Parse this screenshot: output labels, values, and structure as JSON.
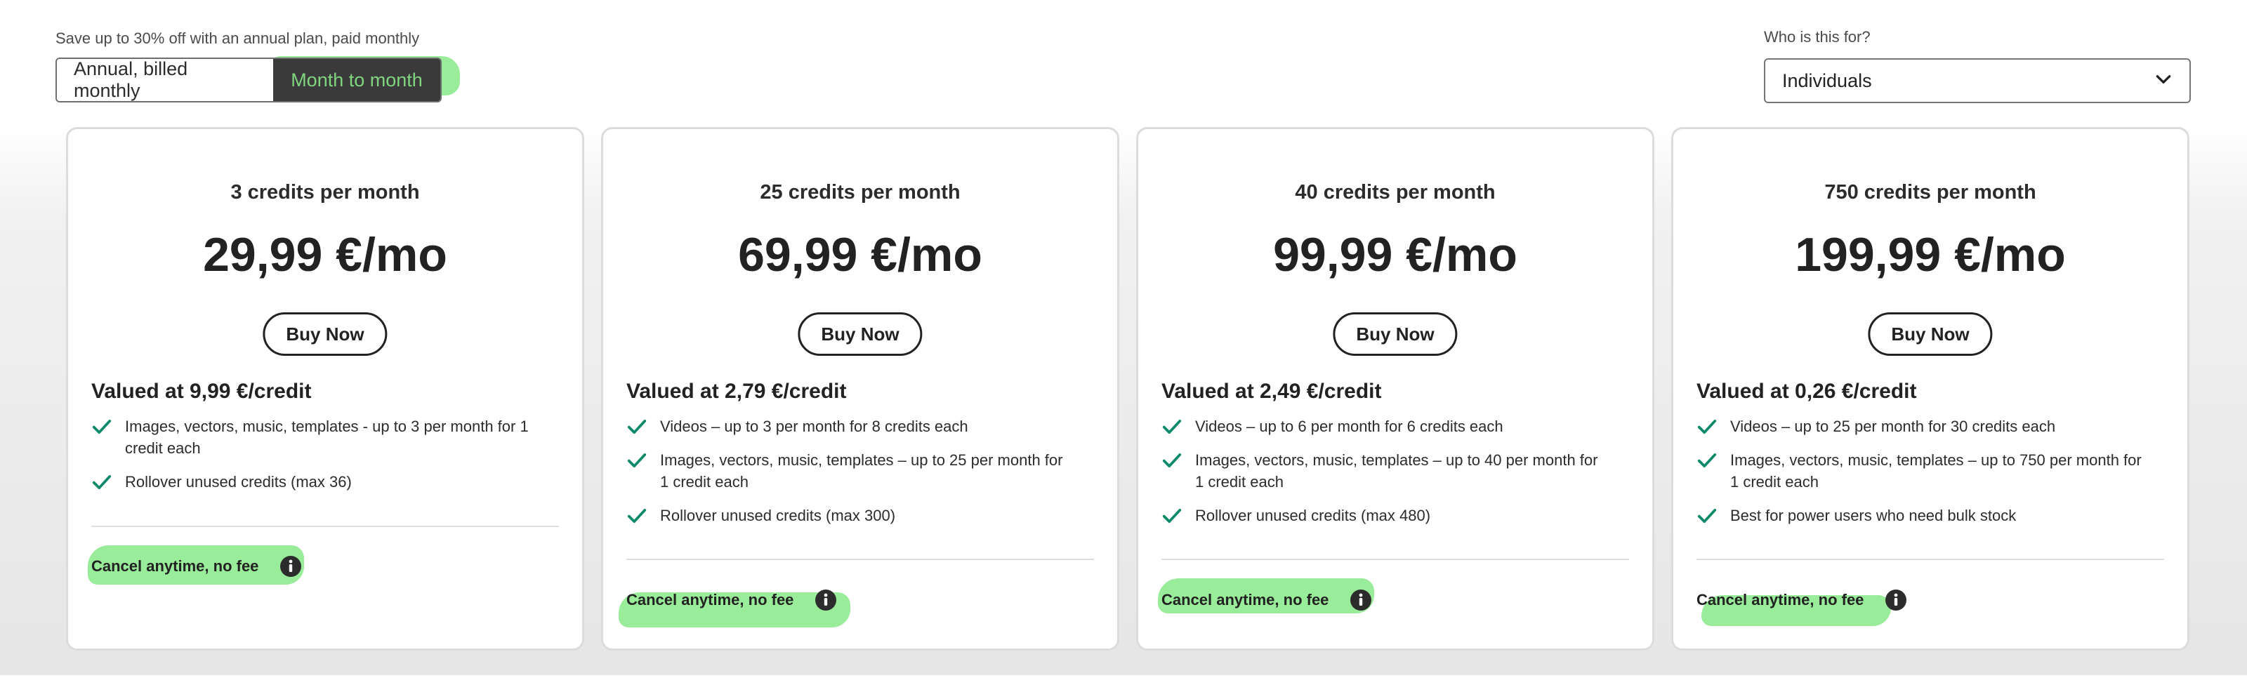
{
  "billing": {
    "save_text": "Save up to 30% off with an annual plan, paid monthly",
    "options": [
      "Annual, billed monthly",
      "Month to month"
    ],
    "selected": "Month to month"
  },
  "audience": {
    "label": "Who is this for?",
    "value": "Individuals"
  },
  "colors": {
    "check": "#0d8a6a",
    "highlight": "#46dc46",
    "toggle_selected_bg": "#3a3a3a"
  },
  "plans": [
    {
      "title": "3 credits per month",
      "price": "29,99 €/mo",
      "buy": "Buy Now",
      "valued": "Valued at 9,99 €/credit",
      "features": [
        "Images, vectors, music, templates - up to 3 per month for 1 credit each",
        "Rollover unused credits (max 36)"
      ],
      "cancel": "Cancel anytime, no fee"
    },
    {
      "title": "25 credits per month",
      "price": "69,99 €/mo",
      "buy": "Buy Now",
      "valued": "Valued at 2,79 €/credit",
      "features": [
        "Videos – up to 3 per month for 8 credits each",
        "Images, vectors, music, templates – up to 25 per month for 1 credit each",
        "Rollover unused credits (max 300)"
      ],
      "cancel": "Cancel anytime, no fee"
    },
    {
      "title": "40 credits per month",
      "price": "99,99 €/mo",
      "buy": "Buy Now",
      "valued": "Valued at 2,49 €/credit",
      "features": [
        "Videos – up to 6 per month for 6 credits each",
        "Images, vectors, music, templates – up to 40 per month for 1 credit each",
        "Rollover unused credits (max 480)"
      ],
      "cancel": "Cancel anytime, no fee"
    },
    {
      "title": "750 credits per month",
      "price": "199,99 €/mo",
      "buy": "Buy Now",
      "valued": "Valued at 0,26 €/credit",
      "features": [
        "Videos – up to 25 per month for 30 credits each",
        "Images, vectors, music, templates – up to 750 per month for 1 credit each",
        "Best for power users who need bulk stock"
      ],
      "cancel": "Cancel anytime, no fee"
    }
  ]
}
